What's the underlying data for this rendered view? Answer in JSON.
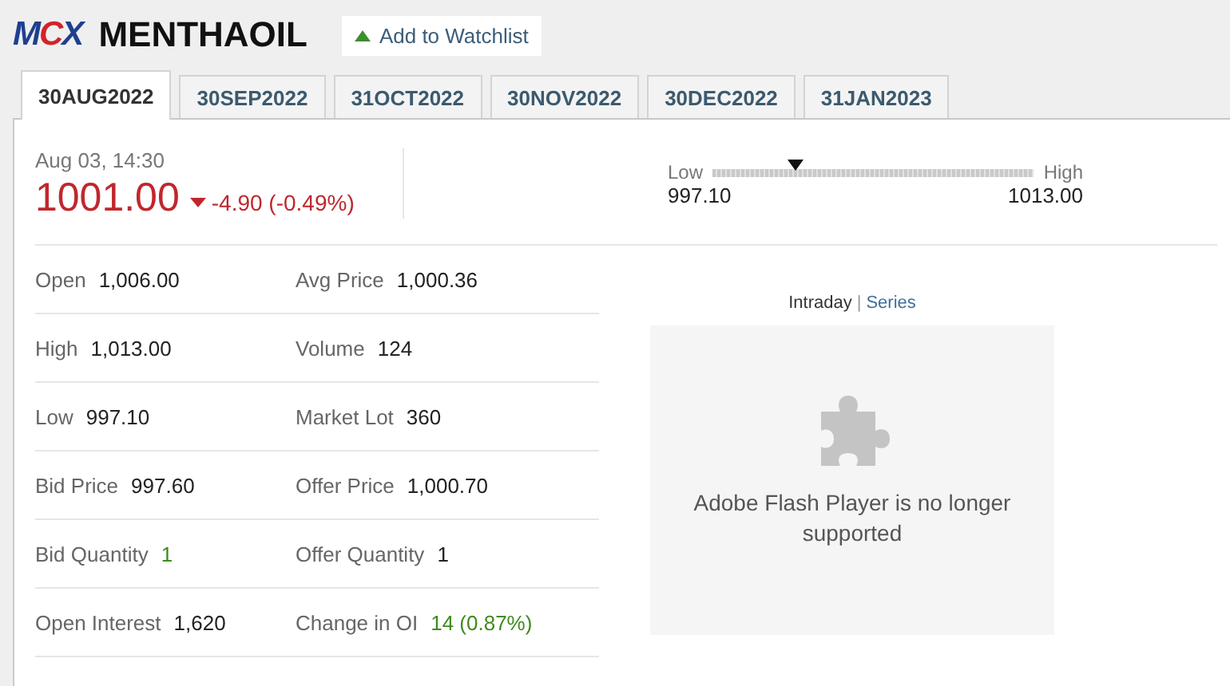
{
  "header": {
    "logo": "MCX",
    "symbol": "MENTHAOIL",
    "watchlist_button": "Add to Watchlist"
  },
  "tabs": [
    {
      "label": "30AUG2022",
      "selected": true
    },
    {
      "label": "30SEP2022",
      "selected": false
    },
    {
      "label": "31OCT2022",
      "selected": false
    },
    {
      "label": "30NOV2022",
      "selected": false
    },
    {
      "label": "30DEC2022",
      "selected": false
    },
    {
      "label": "31JAN2023",
      "selected": false
    }
  ],
  "quote": {
    "timestamp": "Aug 03, 14:30",
    "price": "1001.00",
    "change": "-4.90 (-0.49%)",
    "kind": "loss"
  },
  "range": {
    "low_label": "Low",
    "high_label": "High",
    "low": "997.10",
    "high": "1013.00",
    "level": 0.26
  },
  "stats": [
    {
      "label": "Open",
      "value": "1,006.00"
    },
    {
      "label": "Avg Price",
      "value": "1,000.36"
    },
    {
      "label": "High",
      "value": "1,013.00"
    },
    {
      "label": "Volume",
      "value": "124"
    },
    {
      "label": "Low",
      "value": "997.10"
    },
    {
      "label": "Market Lot",
      "value": "360"
    },
    {
      "label": "Bid Price",
      "value": "997.60"
    },
    {
      "label": "Offer Price",
      "value": "1,000.70"
    },
    {
      "label": "Bid Quantity",
      "value": "1",
      "kind": "gain"
    },
    {
      "label": "Offer Quantity",
      "value": "1"
    },
    {
      "label": "Open Interest",
      "value": "1,620"
    },
    {
      "label": "Change in OI",
      "value": "14 (0.87%)",
      "kind": "gain"
    }
  ],
  "chart_tabs": {
    "items": [
      {
        "label": "Intraday",
        "selected": true
      },
      {
        "label": "Series",
        "selected": false
      }
    ],
    "separator": "|"
  },
  "plugin_message": "Adobe Flash Player is no longer supported"
}
